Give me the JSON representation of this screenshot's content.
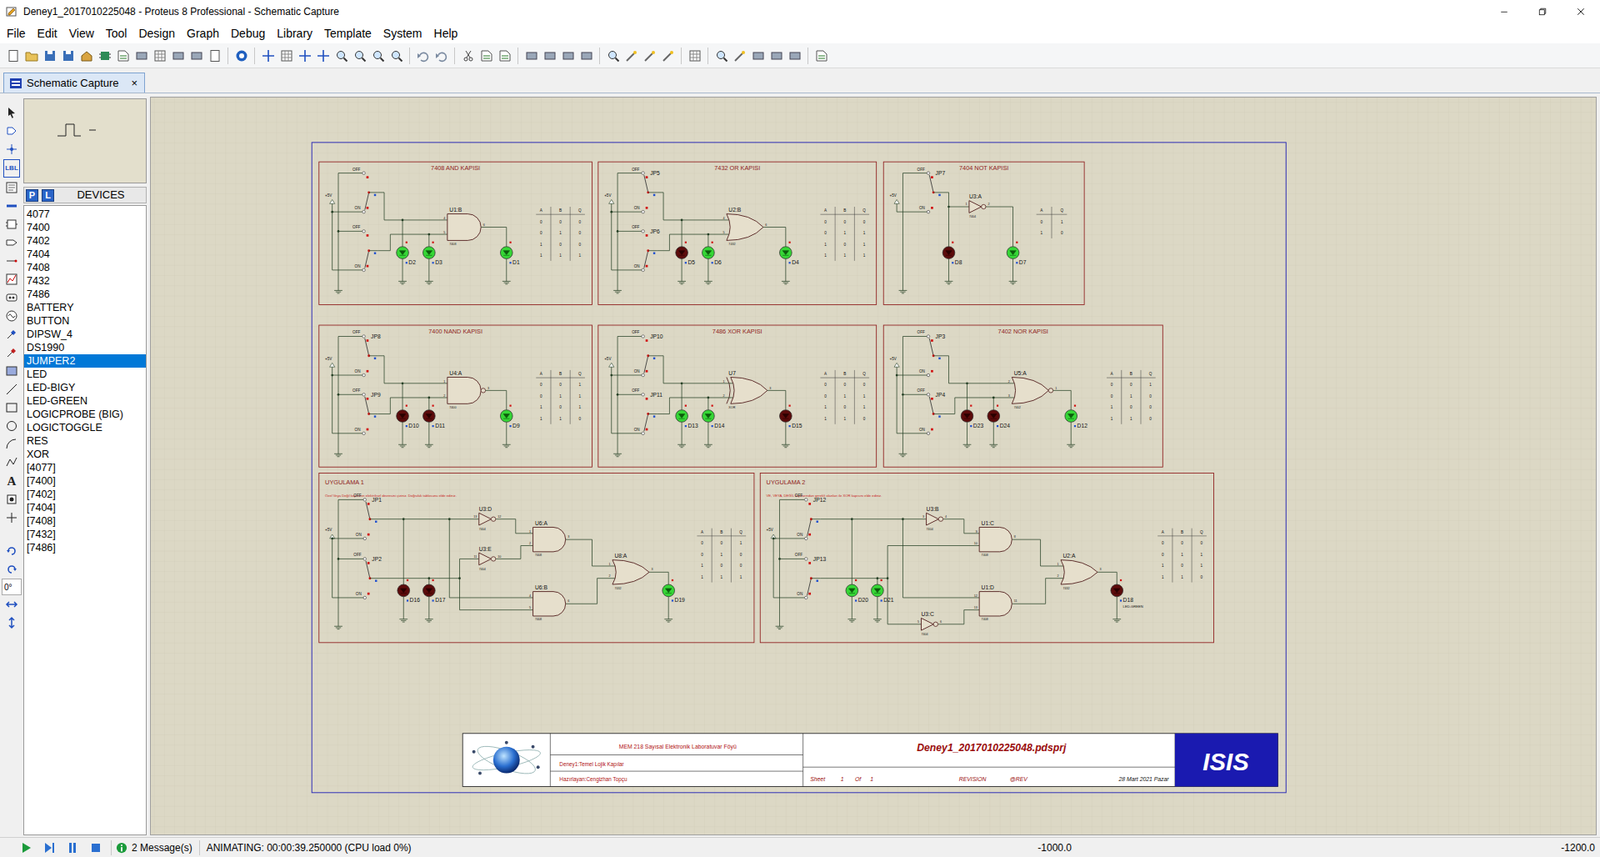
{
  "window": {
    "title": "Deney1_2017010225048 - Proteus 8 Professional - Schematic Capture"
  },
  "menu": [
    "File",
    "Edit",
    "View",
    "Tool",
    "Design",
    "Graph",
    "Debug",
    "Library",
    "Template",
    "System",
    "Help"
  ],
  "tabs": [
    {
      "label": "Schematic Capture",
      "close": "×",
      "selected": true
    }
  ],
  "left_toolbar": {
    "label_tool": "LBL",
    "text_tool": "A",
    "rotation": "0°"
  },
  "devices": {
    "modes": [
      "P",
      "L"
    ],
    "title": "DEVICES",
    "items": [
      {
        "label": "4077",
        "selected": false
      },
      {
        "label": "7400",
        "selected": false
      },
      {
        "label": "7402",
        "selected": false
      },
      {
        "label": "7404",
        "selected": false
      },
      {
        "label": "7408",
        "selected": false
      },
      {
        "label": "7432",
        "selected": false
      },
      {
        "label": "7486",
        "selected": false
      },
      {
        "label": "BATTERY",
        "selected": false
      },
      {
        "label": "BUTTON",
        "selected": false
      },
      {
        "label": "DIPSW_4",
        "selected": false
      },
      {
        "label": "DS1990",
        "selected": false
      },
      {
        "label": "JUMPER2",
        "selected": true
      },
      {
        "label": "LED",
        "selected": false
      },
      {
        "label": "LED-BIGY",
        "selected": false
      },
      {
        "label": "LED-GREEN",
        "selected": false
      },
      {
        "label": "LOGICPROBE (BIG)",
        "selected": false
      },
      {
        "label": "LOGICTOGGLE",
        "selected": false
      },
      {
        "label": "RES",
        "selected": false
      },
      {
        "label": "XOR",
        "selected": false
      },
      {
        "label": "[4077]",
        "selected": false
      },
      {
        "label": "[7400]",
        "selected": false
      },
      {
        "label": "[7402]",
        "selected": false
      },
      {
        "label": "[7404]",
        "selected": false
      },
      {
        "label": "[7408]",
        "selected": false
      },
      {
        "label": "[7432]",
        "selected": false
      },
      {
        "label": "[7486]",
        "selected": false
      }
    ]
  },
  "schematic": {
    "demos": [
      {
        "title": "7408 AND KAPISI",
        "supply": "+5V",
        "switches": [
          {
            "off": "OFF",
            "on": "ON"
          },
          {
            "off": "OFF",
            "on": "ON"
          }
        ],
        "inputs": [
          {
            "ref": "D2",
            "on": true
          },
          {
            "ref": "D3",
            "on": true
          }
        ],
        "gate": {
          "ref": "U1:B",
          "chip": "7408",
          "kind": "and",
          "pins": [
            "4",
            "5",
            "6"
          ]
        },
        "output": {
          "ref": "D1",
          "on": true
        },
        "table": {
          "columns": [
            "A",
            "B",
            "Q"
          ],
          "rows": [
            [
              "0",
              "0",
              "0"
            ],
            [
              "0",
              "1",
              "0"
            ],
            [
              "1",
              "0",
              "0"
            ],
            [
              "1",
              "1",
              "1"
            ]
          ]
        }
      },
      {
        "title": "7432 OR KAPISI",
        "supply": "+5V",
        "switches": [
          {
            "ref": "JP5",
            "off": "OFF",
            "on": "ON"
          },
          {
            "ref": "JP6",
            "off": "OFF",
            "on": "ON"
          }
        ],
        "inputs": [
          {
            "ref": "D5",
            "on": false
          },
          {
            "ref": "D6",
            "on": true
          }
        ],
        "gate": {
          "ref": "U2:B",
          "chip": "7432",
          "kind": "or",
          "pins": [
            "4",
            "5",
            "6"
          ]
        },
        "output": {
          "ref": "D4",
          "on": true
        },
        "table": {
          "columns": [
            "A",
            "B",
            "Q"
          ],
          "rows": [
            [
              "0",
              "0",
              "0"
            ],
            [
              "0",
              "1",
              "1"
            ],
            [
              "1",
              "0",
              "1"
            ],
            [
              "1",
              "1",
              "1"
            ]
          ]
        }
      },
      {
        "title": "7404 NOT KAPISI",
        "supply": "+5V",
        "switches": [
          {
            "ref": "JP7",
            "off": "OFF",
            "on": "ON"
          }
        ],
        "inputs": [
          {
            "ref": "D8",
            "on": false
          }
        ],
        "gate": {
          "ref": "U3:A",
          "chip": "7404",
          "kind": "not",
          "pins": [
            "1",
            "2"
          ]
        },
        "output": {
          "ref": "D7",
          "on": true
        },
        "table": {
          "columns": [
            "A",
            "Q"
          ],
          "rows": [
            [
              "0",
              "1"
            ],
            [
              "1",
              "0"
            ]
          ]
        }
      },
      {
        "title": "7400 NAND KAPISI",
        "supply": "+5V",
        "switches": [
          {
            "ref": "JP8",
            "off": "OFF",
            "on": "ON"
          },
          {
            "ref": "JP9",
            "off": "OFF",
            "on": "ON"
          }
        ],
        "inputs": [
          {
            "ref": "D10",
            "on": false
          },
          {
            "ref": "D11",
            "on": false
          }
        ],
        "gate": {
          "ref": "U4:A",
          "chip": "7400",
          "kind": "nand",
          "pins": [
            "1",
            "2",
            "3"
          ]
        },
        "output": {
          "ref": "D9",
          "on": true
        },
        "table": {
          "columns": [
            "A",
            "B",
            "Q"
          ],
          "rows": [
            [
              "0",
              "0",
              "1"
            ],
            [
              "0",
              "1",
              "1"
            ],
            [
              "1",
              "0",
              "1"
            ],
            [
              "1",
              "1",
              "0"
            ]
          ]
        }
      },
      {
        "title": "7486 XOR KAPISI",
        "supply": "+5V",
        "switches": [
          {
            "ref": "JP10",
            "off": "OFF",
            "on": "ON"
          },
          {
            "ref": "JP11",
            "off": "OFF",
            "on": "ON"
          }
        ],
        "inputs": [
          {
            "ref": "D13",
            "on": true
          },
          {
            "ref": "D14",
            "on": true
          }
        ],
        "gate": {
          "ref": "U7",
          "chip": "XOR",
          "kind": "xor",
          "pins": [
            "1",
            "2",
            "3"
          ]
        },
        "output": {
          "ref": "D15",
          "on": false
        },
        "table": {
          "columns": [
            "A",
            "B",
            "Q"
          ],
          "rows": [
            [
              "0",
              "0",
              "0"
            ],
            [
              "0",
              "1",
              "1"
            ],
            [
              "1",
              "0",
              "1"
            ],
            [
              "1",
              "1",
              "0"
            ]
          ]
        }
      },
      {
        "title": "7402 NOR KAPISI",
        "supply": "+5V",
        "switches": [
          {
            "ref": "JP3",
            "off": "OFF",
            "on": "ON"
          },
          {
            "ref": "JP4",
            "off": "OFF",
            "on": "ON"
          }
        ],
        "inputs": [
          {
            "ref": "D23",
            "on": false
          },
          {
            "ref": "D24",
            "on": false
          }
        ],
        "gate": {
          "ref": "U5:A",
          "chip": "7402",
          "kind": "nor",
          "pins": [
            "2",
            "3",
            "1"
          ]
        },
        "output": {
          "ref": "D12",
          "on": true
        },
        "table": {
          "columns": [
            "A",
            "B",
            "Q"
          ],
          "rows": [
            [
              "0",
              "0",
              "1"
            ],
            [
              "0",
              "1",
              "0"
            ],
            [
              "1",
              "0",
              "0"
            ],
            [
              "1",
              "1",
              "0"
            ]
          ]
        }
      }
    ],
    "apps": [
      {
        "title": "UYGULAMA 1",
        "note": "Özel Veya Değil kapısının elektriksel devresini çiziniz. Doğruluk tablosunu elde ediniz.",
        "supply": "+5V",
        "switches": [
          {
            "ref": "JP1",
            "off": "OFF",
            "on": "ON"
          },
          {
            "ref": "JP2",
            "off": "OFF",
            "on": "ON"
          }
        ],
        "inputs": [
          {
            "ref": "D16",
            "on": false
          },
          {
            "ref": "D17",
            "on": false
          }
        ],
        "inverters": [
          {
            "ref": "U3:D",
            "chip": "7404",
            "pins": [
              "13",
              "12"
            ]
          },
          {
            "ref": "U3:E",
            "chip": "7404",
            "pins": [
              "11",
              "10"
            ]
          }
        ],
        "ands": [
          {
            "ref": "U6:A",
            "chip": "7408",
            "pins": [
              "1",
              "2",
              "3"
            ]
          },
          {
            "ref": "U6:B",
            "chip": "7408",
            "pins": [
              "4",
              "5",
              "6"
            ]
          }
        ],
        "or": {
          "ref": "U8:A",
          "chip": "7432",
          "pins": [
            "1",
            "2",
            "3"
          ]
        },
        "output": {
          "ref": "D19",
          "on": true
        },
        "table": {
          "columns": [
            "A",
            "B",
            "Q"
          ],
          "rows": [
            [
              "0",
              "0",
              "1"
            ],
            [
              "0",
              "1",
              "0"
            ],
            [
              "1",
              "0",
              "0"
            ],
            [
              "1",
              "1",
              "1"
            ]
          ]
        }
      },
      {
        "title": "UYGULAMA 2",
        "note": "VE, VEYA, DEĞİL kapılarından gerekli olanları ile XOR kapısını elde ediniz.",
        "supply": "+5V",
        "switches": [
          {
            "ref": "JP12",
            "off": "OFF",
            "on": "ON"
          },
          {
            "ref": "JP13",
            "off": "OFF",
            "on": "ON"
          }
        ],
        "inputs": [
          {
            "ref": "D20",
            "on": true
          },
          {
            "ref": "D21",
            "on": true
          }
        ],
        "inverters": [
          {
            "ref": "U3:B",
            "chip": "7404",
            "pins": [
              "3",
              "4"
            ]
          },
          {
            "ref": "U3:C",
            "chip": "7404",
            "pins": [
              "5",
              "6"
            ]
          }
        ],
        "ands": [
          {
            "ref": "U1:C",
            "chip": "7408",
            "pins": [
              "9",
              "10",
              "8"
            ]
          },
          {
            "ref": "U1:D",
            "chip": "7408",
            "pins": [
              "12",
              "13",
              "11"
            ]
          }
        ],
        "or": {
          "ref": "U2:A",
          "chip": "7432",
          "pins": [
            "1",
            "2",
            "3"
          ]
        },
        "output": {
          "ref": "D18",
          "on": false,
          "model": "LED-GREEN"
        },
        "table": {
          "columns": [
            "A",
            "B",
            "Q"
          ],
          "rows": [
            [
              "0",
              "0",
              "0"
            ],
            [
              "0",
              "1",
              "1"
            ],
            [
              "1",
              "0",
              "1"
            ],
            [
              "1",
              "1",
              "0"
            ]
          ]
        }
      }
    ],
    "title_block": {
      "course": "MEM 218 Sayısal Elektronik Laboratuvar Föyü",
      "experiment": "Deney1:Temel Lojik Kapılar",
      "author": "Hazırlayan:Cengizhan Topçu",
      "file": "Deney1_2017010225048.pdsprj",
      "sheet_label": "Sheet",
      "sheet": "1",
      "of_label": "Of",
      "sheets": "1",
      "revision_label": "REVISION",
      "revision": "@REV",
      "date": "28 Mart 2021 Pazar",
      "logo": "ISIS"
    }
  },
  "status_bar": {
    "messages": "2 Message(s)",
    "simulation": "ANIMATING: 00:00:39.250000 (CPU load 0%)",
    "x": "-1000.0",
    "y": "-1200.0"
  }
}
